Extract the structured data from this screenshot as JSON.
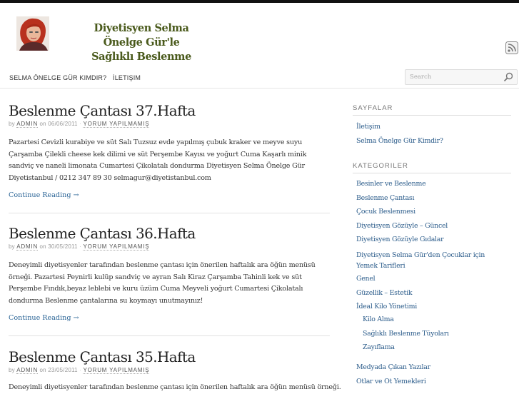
{
  "site": {
    "title_line1": "Diyetisyen Selma Önelge Gür'le",
    "title_line2": "Sağlıklı Beslenme"
  },
  "nav": {
    "items": [
      "SELMA ÖNELGE GÜR KIMDIR?",
      "İLETIŞIM"
    ]
  },
  "search": {
    "placeholder": "Search"
  },
  "posts": [
    {
      "title": "Beslenme Çantası 37.Hafta",
      "by": "by",
      "author": "ADMIN",
      "on": "on",
      "date": "06/06/2011",
      "sep": "·",
      "comments": "YORUM YAPILMAMIŞ",
      "body": "Pazartesi Cevizli kurabiye ve süt Salı Tuzsuz evde yapılmış çubuk kraker ve  meyve suyu Çarşamba Çilekli cheese kek dilimi ve süt Perşembe Kayısı ve yoğurt Cuma Kaşarlı minik sandviç ve naneli limonata Cumartesi Çikolatalı dondurma Diyetisyen Selma Önelge Gür Diyetistanbul / 0212 347 89 30 selmagur@diyetistanbul.com",
      "more": "Continue Reading →"
    },
    {
      "title": "Beslenme Çantası 36.Hafta",
      "by": "by",
      "author": "ADMIN",
      "on": "on",
      "date": "30/05/2011",
      "sep": "·",
      "comments": "YORUM YAPILMAMIŞ",
      "body": "Deneyimli diyetisyenler tarafından beslenme çantası için önerilen haftalık ara öğün menüsü örneği. Pazartesi Peynirli kulüp sandviç ve ayran Salı Kiraz Çarşamba Tahinli kek ve süt Perşembe Fındık,beyaz leblebi ve kuru üzüm Cuma Meyveli yoğurt Cumartesi Çikolatalı dondurma Beslenme çantalarına su koymayı unutmayınız!",
      "more": "Continue Reading →"
    },
    {
      "title": "Beslenme Çantası 35.Hafta",
      "by": "by",
      "author": "ADMIN",
      "on": "on",
      "date": "23/05/2011",
      "sep": "·",
      "comments": "YORUM YAPILMAMIŞ",
      "body": "Deneyimli diyetisyenler tarafından beslenme çantası için önerilen haftalık ara öğün menüsü örneği.",
      "more": ""
    }
  ],
  "sidebar": {
    "pages_heading": "SAYFALAR",
    "pages": [
      "İletişim",
      "Selma Önelge Gür Kimdir?"
    ],
    "categories_heading": "KATEGORILER",
    "categories": [
      "Besinler ve Beslenme",
      "Beslenme Çantası",
      "Çocuk Beslenmesi",
      "Diyetisyen Gözüyle – Güncel",
      "Diyetisyen Gözüyle Gıdalar",
      "Diyetisyen Selma Gür'den Çocuklar için Yemek Tarifleri",
      "Genel",
      "Güzellik – Estetik",
      "İdeal Kilo Yönetimi"
    ],
    "subcategories": [
      "Kilo Alma",
      "Sağlıklı Beslenme Tüyoları",
      "Zayıflama"
    ],
    "categories_more": [
      "Medyada Çıkan Yazılar",
      "Otlar ve Ot Yemekleri"
    ]
  },
  "colors": {
    "title": "#4a5a1c",
    "link": "#2a5b8a",
    "topbar": "#111111"
  },
  "icons": [
    "rss-icon",
    "search-icon",
    "avatar-photo"
  ]
}
